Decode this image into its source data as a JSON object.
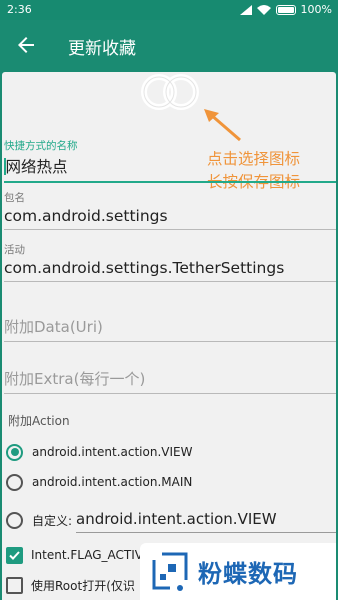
{
  "status_bar": {
    "time": "2:36",
    "battery": "100%"
  },
  "app_bar": {
    "title": "更新收藏"
  },
  "hint": {
    "line1": "点击选择图标",
    "line2": "长按保存图标"
  },
  "fields": {
    "shortcut_name": {
      "label": "快捷方式的名称",
      "value": "网络热点"
    },
    "package": {
      "label": "包名",
      "value": "com.android.settings"
    },
    "activity": {
      "label": "活动",
      "value": "com.android.settings.TetherSettings"
    },
    "data_uri": {
      "placeholder": "附加Data(Uri)"
    },
    "extra": {
      "placeholder": "附加Extra(每行一个)"
    }
  },
  "action": {
    "label": "附加Action",
    "options": [
      {
        "label": "android.intent.action.VIEW",
        "selected": true
      },
      {
        "label": "android.intent.action.MAIN",
        "selected": false
      },
      {
        "label": "自定义:",
        "selected": false
      }
    ],
    "custom_value": "android.intent.action.VIEW"
  },
  "checkboxes": [
    {
      "label": "Intent.FLAG_ACTIV",
      "checked": true
    },
    {
      "label": "使用Root打开(仅识",
      "checked": false
    }
  ],
  "watermark": {
    "text": "粉蝶数码"
  },
  "colors": {
    "primary": "#1a8b72",
    "accent": "#22a98a",
    "hint": "#f0943a",
    "watermark": "#1d67b5"
  }
}
